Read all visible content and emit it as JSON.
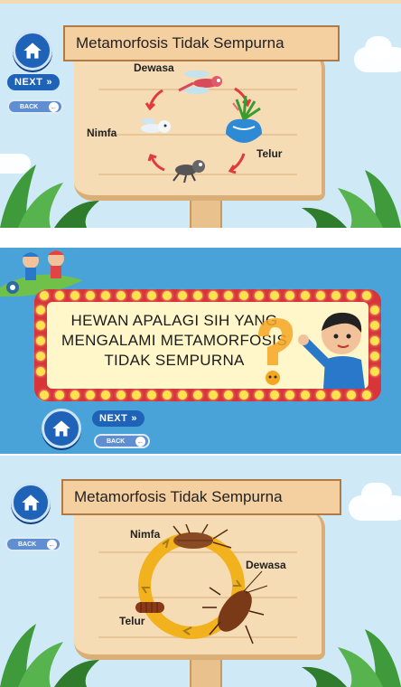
{
  "slide1": {
    "title": "Metamorfosis Tidak Sempurna",
    "next_label": "NEXT",
    "back_label": "BACK",
    "stages": {
      "top": "Dewasa",
      "left": "Nimfa",
      "right": "Telur"
    }
  },
  "slide2": {
    "question": "HEWAN APALAGI SIH YANG MENGALAMI METAMORFOSIS TIDAK SEMPURNA",
    "next_label": "NEXT",
    "back_label": "BACK"
  },
  "slide3": {
    "title": "Metamorfosis Tidak Sempurna",
    "back_label": "BACK",
    "stages": {
      "nymph": "Nimfa",
      "adult": "Dewasa",
      "egg": "Telur"
    }
  },
  "colors": {
    "sky": "#cfe9f7",
    "quiz_bg": "#4aa3d8",
    "marquee": "#d8343a",
    "button": "#1f63b8",
    "arrow": "#e03a3a",
    "cycle": "#f2b21d"
  }
}
